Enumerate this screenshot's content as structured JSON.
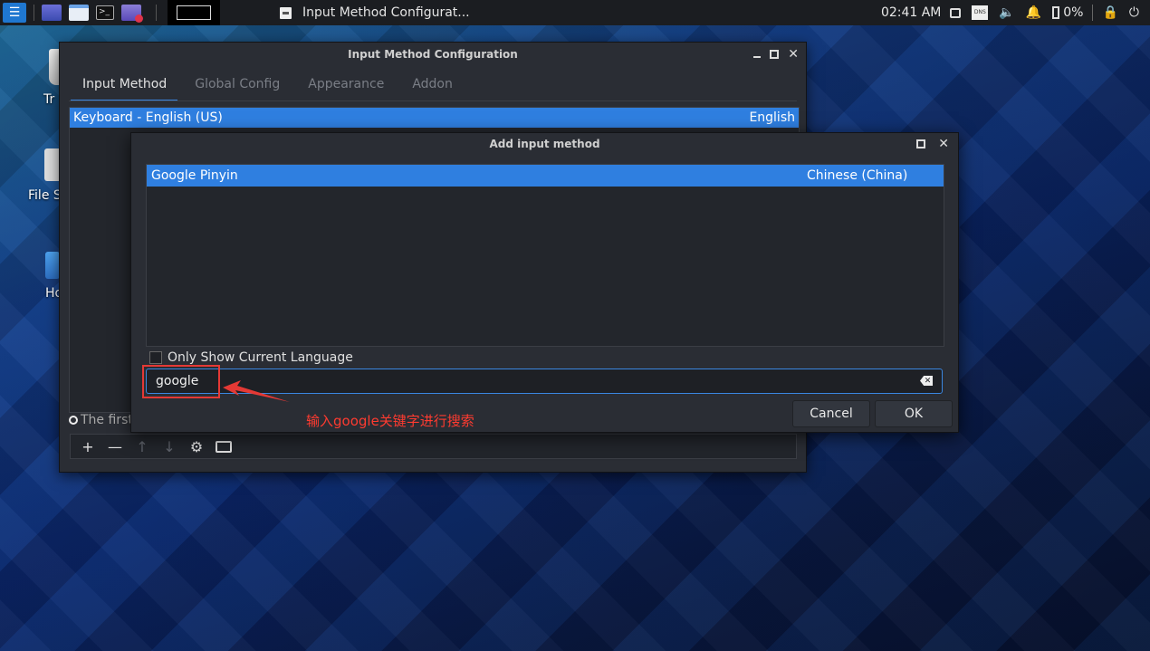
{
  "taskbar": {
    "window_title": "Input Method Configurat...",
    "clock": "02:41 AM",
    "battery": "0%"
  },
  "desktop": {
    "icons": [
      {
        "label": "Tr"
      },
      {
        "label": "File S"
      },
      {
        "label": "Ho"
      }
    ]
  },
  "main_window": {
    "title": "Input Method Configuration",
    "tabs": [
      "Input Method",
      "Global Config",
      "Appearance",
      "Addon"
    ],
    "active_tab": "Input Method",
    "input_methods": [
      {
        "name": "Keyboard - English (US)",
        "language": "English"
      }
    ],
    "hint_text": "The first"
  },
  "dialog": {
    "title": "Add input method",
    "results": [
      {
        "name": "Google Pinyin",
        "language": "Chinese (China)"
      }
    ],
    "only_current_language_label": "Only Show Current Language",
    "only_current_language_checked": false,
    "search_value": "google",
    "cancel_label": "Cancel",
    "ok_label": "OK"
  },
  "annotation": {
    "text": "输入google关键字进行搜索",
    "color": "#ff3b30"
  },
  "colors": {
    "accent": "#2f7fe0",
    "window_bg": "#2a2d34"
  }
}
